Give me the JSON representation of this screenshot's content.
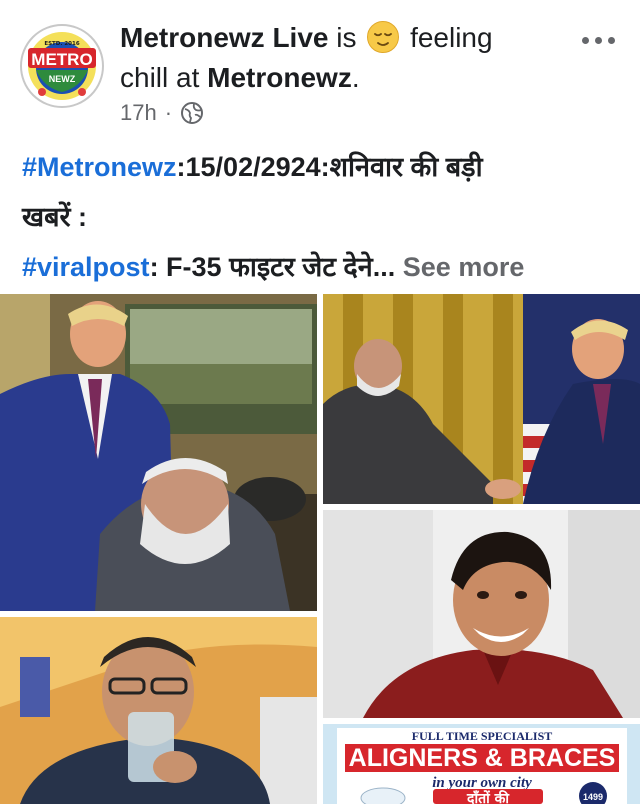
{
  "post": {
    "author": "Metronewz Live",
    "is_text": "is",
    "feeling_text": "feeling",
    "activity": "chill at",
    "place": "Metronewz",
    "place_suffix": ".",
    "emoji": "relieved-face-emoji",
    "time": "17h",
    "separator": "·",
    "audience_icon": "globe-icon",
    "more_icon": "more-options-icon"
  },
  "avatar": {
    "logo_top": "ESTD. 2016",
    "logo_main": "METRO",
    "logo_sub": "NEWZ"
  },
  "body": {
    "hashtag1": "#Metronewz",
    "line1_rest": ":15/02/2924:शनिवार की बड़ी",
    "line2": "खबरें :",
    "hashtag2": "#viralpost",
    "line3_rest": ": F-35 फाइटर जेट देने...",
    "see_more": "See more"
  },
  "photos": [
    {
      "name": "photo-trump-modi-meeting"
    },
    {
      "name": "photo-modi-trump-handshake"
    },
    {
      "name": "photo-smiling-young-man"
    },
    {
      "name": "photo-kejriwal-drinking-water"
    },
    {
      "name": "photo-aligners-braces-ad"
    }
  ],
  "ad": {
    "line1": "FULL TIME SPECIALIST",
    "line2": "ALIGNERS & BRACES",
    "line3": "in your own city",
    "line4": "दाँतों की",
    "badge": "1499"
  },
  "colors": {
    "link": "#1a6ed8",
    "secondary_text": "#65676b",
    "primary_text": "#1c1e21",
    "ad_red": "#d7262c",
    "ad_navy": "#1b2a6b"
  }
}
